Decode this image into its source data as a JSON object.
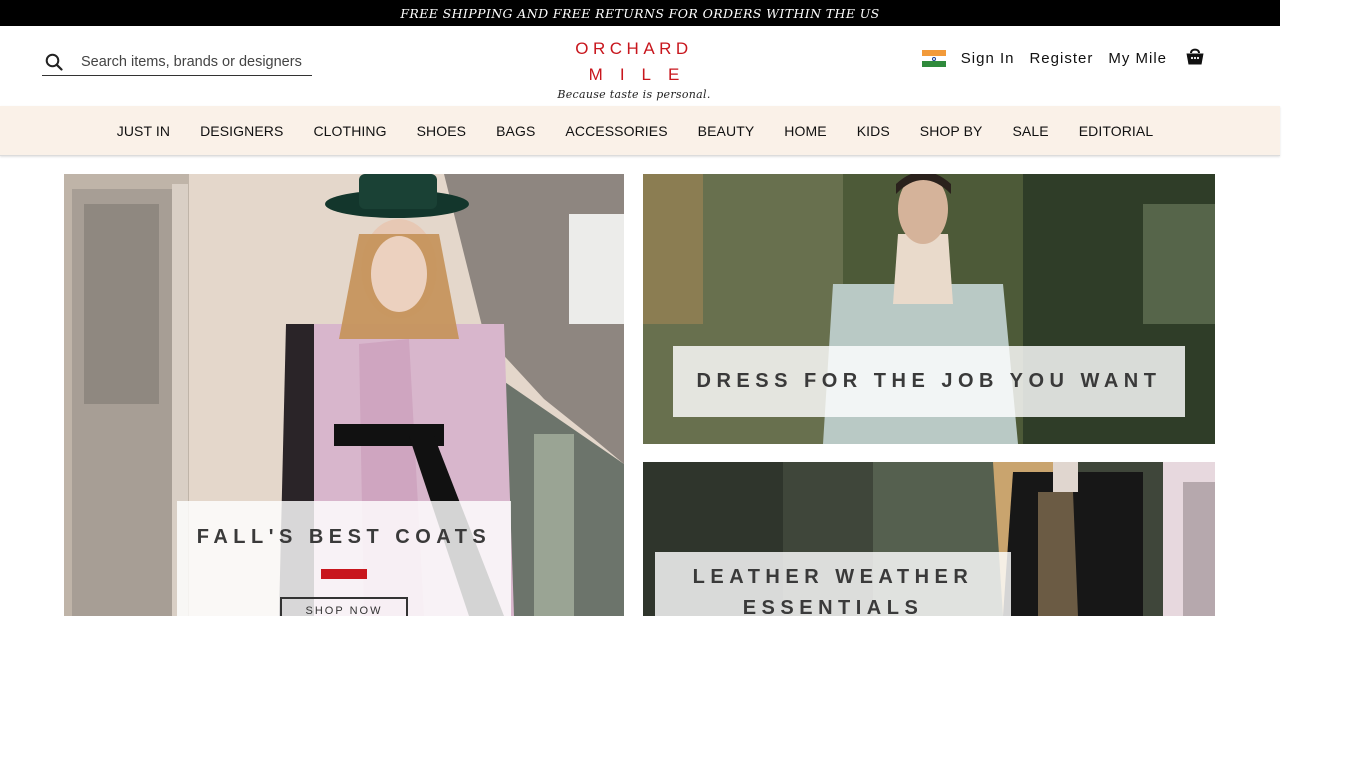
{
  "promo": {
    "text": "FREE SHIPPING AND FREE RETURNS FOR ORDERS WITHIN THE US"
  },
  "search": {
    "placeholder": "Search items, brands or designers",
    "icon": "search-icon"
  },
  "logo": {
    "line1": "ORCHARD",
    "line2": "MILE",
    "tagline": "Because taste is personal."
  },
  "account": {
    "flag_icon": "india-flag-icon",
    "sign_in": "Sign In",
    "register": "Register",
    "my_mile": "My Mile",
    "bag_icon": "shopping-bag-icon"
  },
  "nav": {
    "items": [
      "JUST IN",
      "DESIGNERS",
      "CLOTHING",
      "SHOES",
      "BAGS",
      "ACCESSORIES",
      "BEAUTY",
      "HOME",
      "KIDS",
      "SHOP BY",
      "SALE",
      "EDITORIAL"
    ]
  },
  "tiles": {
    "coats": {
      "title": "FALL'S BEST COATS",
      "cta": "SHOP NOW"
    },
    "job": {
      "title": "DRESS FOR THE JOB YOU WANT"
    },
    "leather": {
      "title_line1": "LEATHER WEATHER",
      "title_line2": "ESSENTIALS"
    }
  },
  "colors": {
    "brand_red": "#c8161d",
    "nav_bg": "#faf1e8",
    "promo_bg": "#000000"
  }
}
